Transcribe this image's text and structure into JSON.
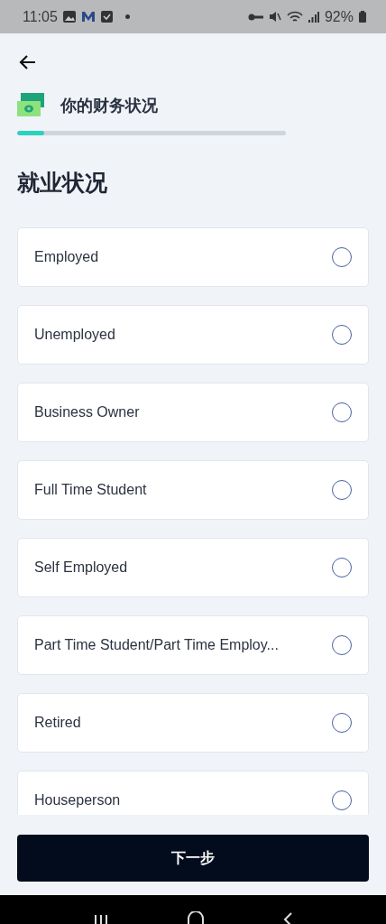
{
  "status_bar": {
    "time": "11:05",
    "battery": "92%"
  },
  "header": {
    "title": "你的财务状况",
    "progress": {
      "level": 0.1
    }
  },
  "heading": "就业状况",
  "options": [
    {
      "label": "Employed",
      "selected": false
    },
    {
      "label": "Unemployed",
      "selected": false
    },
    {
      "label": "Business Owner",
      "selected": false
    },
    {
      "label": "Full Time Student",
      "selected": false
    },
    {
      "label": "Self Employed",
      "selected": false
    },
    {
      "label": "Part Time Student/Part Time Employ...",
      "selected": false
    },
    {
      "label": "Retired",
      "selected": false
    },
    {
      "label": "Houseperson",
      "selected": false
    }
  ],
  "next_button": "下一步"
}
